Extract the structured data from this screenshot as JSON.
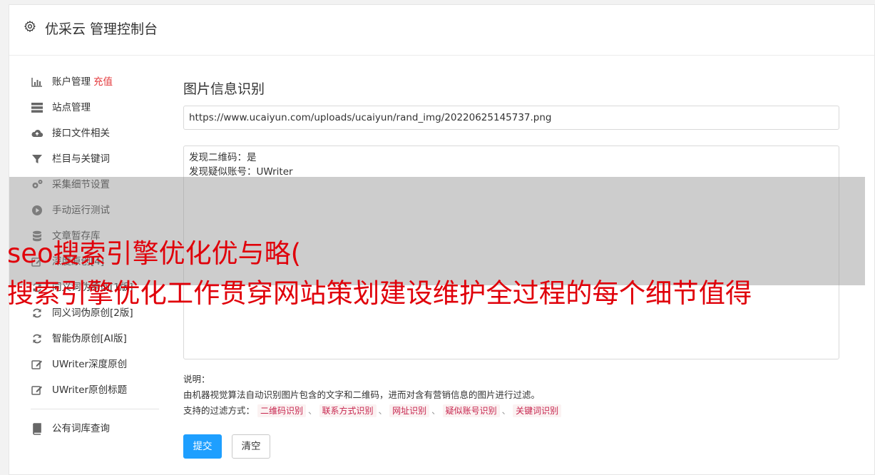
{
  "header": {
    "title": "优采云 管理控制台"
  },
  "sidebar": {
    "items": [
      {
        "label": "账户管理",
        "badge": "充值",
        "icon": "bar-chart-icon"
      },
      {
        "label": "站点管理",
        "icon": "server-icon"
      },
      {
        "label": "接口文件相关",
        "icon": "cloud-upload-icon"
      },
      {
        "label": "栏目与关键词",
        "icon": "filter-icon"
      },
      {
        "label": "采集细节设置",
        "icon": "gears-icon"
      },
      {
        "label": "手动运行测试",
        "icon": "play-circle-icon"
      },
      {
        "label": "文章暂存库",
        "icon": "database-icon"
      },
      {
        "label": "深度原创[4]",
        "icon": "edit-icon"
      },
      {
        "label": "同义词伪原创[1版]",
        "icon": "refresh-icon"
      },
      {
        "label": "同义词伪原创[2版]",
        "icon": "refresh-icon"
      },
      {
        "label": "智能伪原创[AI版]",
        "icon": "refresh-icon"
      },
      {
        "label": "UWriter深度原创",
        "icon": "edit-icon"
      },
      {
        "label": "UWriter原创标题",
        "icon": "edit-icon"
      },
      {
        "label": "公有词库查询",
        "icon": "book-icon"
      }
    ]
  },
  "main": {
    "title": "图片信息识别",
    "url_value": "https://www.ucaiyun.com/uploads/ucaiyun/rand_img/20220625145737.png",
    "result_lines": [
      "发现二维码：是",
      "发现疑似账号：UWriter"
    ],
    "desc_label": "说明：",
    "desc_text": "由机器视觉算法自动识别图片包含的文字和二维码，进而对含有营销信息的图片进行过滤。",
    "filter_label": "支持的过滤方式：",
    "filters": [
      "二维码识别",
      "联系方式识别",
      "网址识别",
      "疑似账号识别",
      "关键词识别"
    ],
    "filter_sep": "、",
    "submit_label": "提交",
    "clear_label": "清空"
  },
  "overlay": {
    "line1": "seo搜索引擎优化优与略(",
    "line2": "搜索引擎优化工作贯穿网站策划建设维护全过程的每个细节值得"
  },
  "colors": {
    "accent": "#1e9fff",
    "badge": "#e4393c",
    "overlay_text": "#e0000a"
  }
}
